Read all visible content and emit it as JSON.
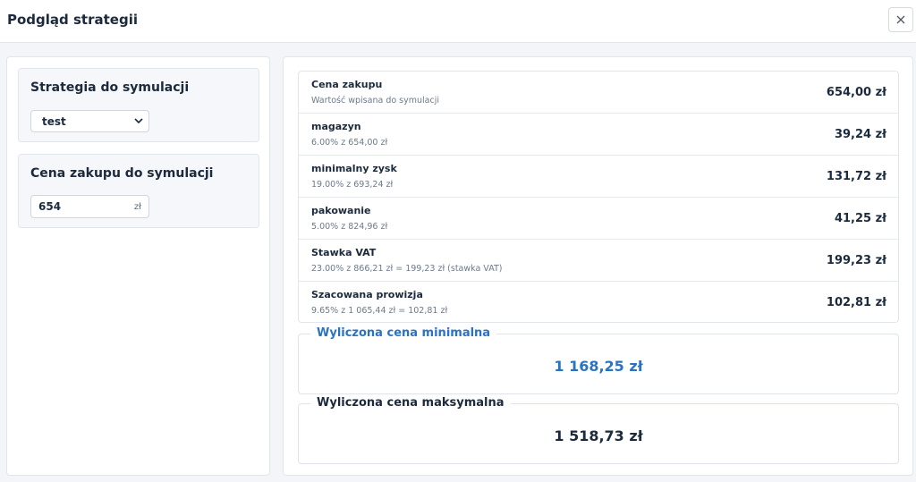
{
  "header": {
    "title": "Podgląd strategii"
  },
  "strategy_card": {
    "title": "Strategia do symulacji",
    "selected_value": "test"
  },
  "price_card": {
    "title": "Cena zakupu do symulacji",
    "value": "654",
    "suffix": "zł"
  },
  "breakdown": [
    {
      "label": "Cena zakupu",
      "sub": "Wartość wpisana do symulacji",
      "amount": "654,00 zł"
    },
    {
      "label": "magazyn",
      "sub": "6.00% z 654,00 zł",
      "amount": "39,24 zł"
    },
    {
      "label": "minimalny zysk",
      "sub": "19.00% z 693,24 zł",
      "amount": "131,72 zł"
    },
    {
      "label": "pakowanie",
      "sub": "5.00% z 824,96 zł",
      "amount": "41,25 zł"
    },
    {
      "label": "Stawka VAT",
      "sub": "23.00% z 866,21 zł = 199,23 zł (stawka VAT)",
      "amount": "199,23 zł"
    },
    {
      "label": "Szacowana prowizja",
      "sub": "9.65% z 1 065,44 zł = 102,81 zł",
      "amount": "102,81 zł"
    }
  ],
  "result_min": {
    "label": "Wyliczona cena minimalna",
    "value": "1 168,25 zł"
  },
  "result_max": {
    "label": "Wyliczona cena maksymalna",
    "value": "1 518,73 zł"
  },
  "colors": {
    "accent": "#2a73c2",
    "text": "#1b2a3c",
    "muted": "#6b7a8c"
  }
}
